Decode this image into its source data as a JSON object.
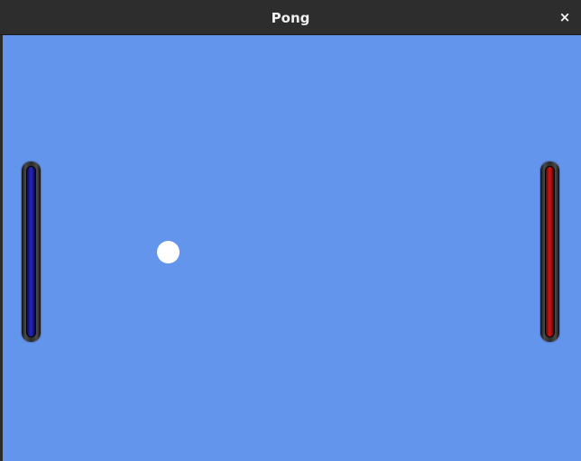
{
  "window": {
    "title": "Pong",
    "close_label": "×"
  },
  "game": {
    "background_color": "#6495ed",
    "left_paddle_color": "#2525c0",
    "right_paddle_color": "#d01515",
    "ball_color": "#ffffff"
  }
}
